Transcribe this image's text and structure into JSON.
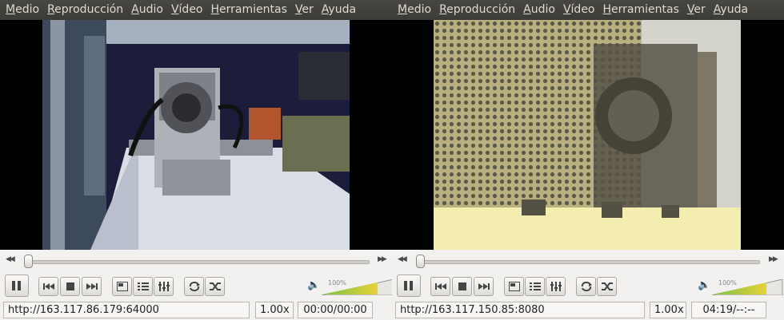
{
  "players": [
    {
      "menu": [
        "Medio",
        "Reproducción",
        "Audio",
        "Vídeo",
        "Herramientas",
        "Ver",
        "Ayuda"
      ],
      "volume_label": "100%",
      "volume_level": 1.0,
      "playback_progress": 0.0,
      "url": "http://163.117.86.179:64000",
      "speed": "1.00x",
      "time": "00:00/00:00"
    },
    {
      "menu": [
        "Medio",
        "Reproducción",
        "Audio",
        "Vídeo",
        "Herramientas",
        "Ver",
        "Ayuda"
      ],
      "volume_label": "100%",
      "volume_level": 1.0,
      "playback_progress": 0.0,
      "url": "http://163.117.150.85:8080",
      "speed": "1.00x",
      "time": "04:19/--:--"
    }
  ],
  "icons": {
    "seek_back": "rewind-icon",
    "seek_forward": "fast-forward-icon",
    "play_pause": "pause-icon",
    "prev": "previous-icon",
    "stop": "stop-icon",
    "next": "next-icon",
    "fullscreen": "fullscreen-icon",
    "playlist": "playlist-icon",
    "extended": "equalizer-icon",
    "loop": "loop-icon",
    "random": "shuffle-icon",
    "volume": "speaker-icon"
  },
  "colors": {
    "menubar": "#3c3b37",
    "menu_text": "#dfdbd2",
    "panel": "#f2f1f0",
    "volume_green": "#7ac142",
    "volume_yellow": "#e8d23a"
  }
}
